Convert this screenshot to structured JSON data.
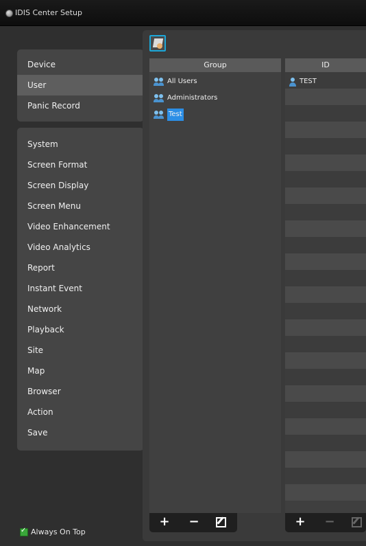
{
  "window": {
    "title": "IDIS Center Setup"
  },
  "menu": {
    "top_items": [
      {
        "label": "Device"
      },
      {
        "label": "User",
        "selected": true
      },
      {
        "label": "Panic Record"
      }
    ],
    "bottom_items": [
      {
        "label": "System"
      },
      {
        "label": "Screen Format"
      },
      {
        "label": "Screen Display"
      },
      {
        "label": "Screen Menu"
      },
      {
        "label": "Video Enhancement"
      },
      {
        "label": "Video Analytics"
      },
      {
        "label": "Report"
      },
      {
        "label": "Instant Event"
      },
      {
        "label": "Network"
      },
      {
        "label": "Playback"
      },
      {
        "label": "Site"
      },
      {
        "label": "Map"
      },
      {
        "label": "Browser"
      },
      {
        "label": "Action"
      },
      {
        "label": "Save"
      }
    ]
  },
  "group_panel": {
    "header": "Group",
    "items": [
      {
        "label": "All Users"
      },
      {
        "label": "Administrators"
      },
      {
        "label": "Test",
        "selected": true
      }
    ],
    "buttons": {
      "add": "+",
      "remove": "−"
    }
  },
  "id_panel": {
    "header": "ID",
    "items": [
      {
        "label": "TEST"
      }
    ],
    "buttons": {
      "add": "+",
      "remove": "−"
    }
  },
  "footer": {
    "always_on_top_label": "Always On Top",
    "always_on_top_checked": true
  },
  "colors": {
    "accent": "#2b8ee6",
    "toolbar_focus": "#1ba7d8",
    "checkbox": "#3aa63a"
  }
}
